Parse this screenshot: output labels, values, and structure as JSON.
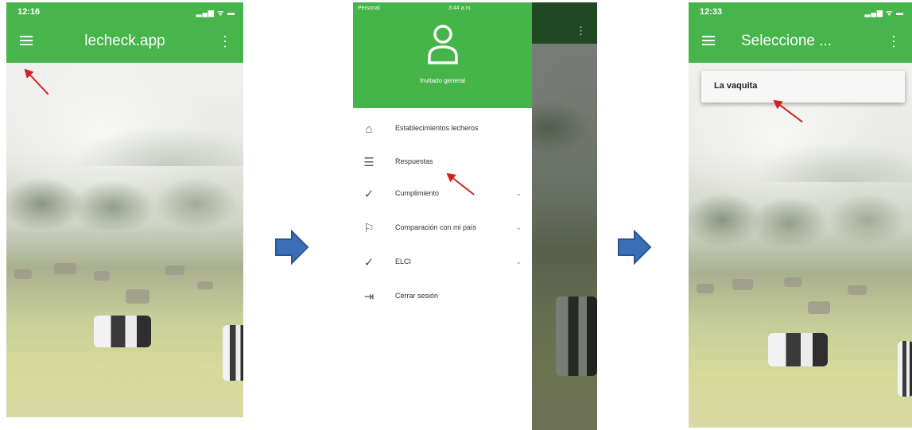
{
  "screen1": {
    "status_time": "12:16",
    "status_icons": "▂▄▆ ᯤ ▬",
    "app_title": "lecheck.app",
    "menu_icon": "hamburger-icon",
    "more_icon": "more-vertical-icon"
  },
  "screen2": {
    "status_carrier": "Personal",
    "status_time": "3:44 a.m.",
    "user_icon": "user-icon",
    "user_label": "Invitado general",
    "menu": [
      {
        "label": "Establecimientos lecheros",
        "icon": "barn-icon",
        "expandable": false
      },
      {
        "label": "Respuestas",
        "icon": "checklist-icon",
        "expandable": false
      },
      {
        "label": "Cumplimiento",
        "icon": "double-check-icon",
        "expandable": true
      },
      {
        "label": "Comparación con mi país",
        "icon": "flag-icon",
        "expandable": true
      },
      {
        "label": "ELCI",
        "icon": "check-icon",
        "expandable": true
      },
      {
        "label": "Cerrar sesión",
        "icon": "logout-icon",
        "expandable": false
      }
    ]
  },
  "screen3": {
    "status_time": "12:33",
    "status_icons": "▂▄▆ ᯤ ▬",
    "app_title": "Seleccione ...",
    "dropdown_option": "La vaquita"
  },
  "colors": {
    "appbar": "#47b54b",
    "annotation_arrow": "#d62020",
    "flow_arrow": "#3a6fb8"
  }
}
